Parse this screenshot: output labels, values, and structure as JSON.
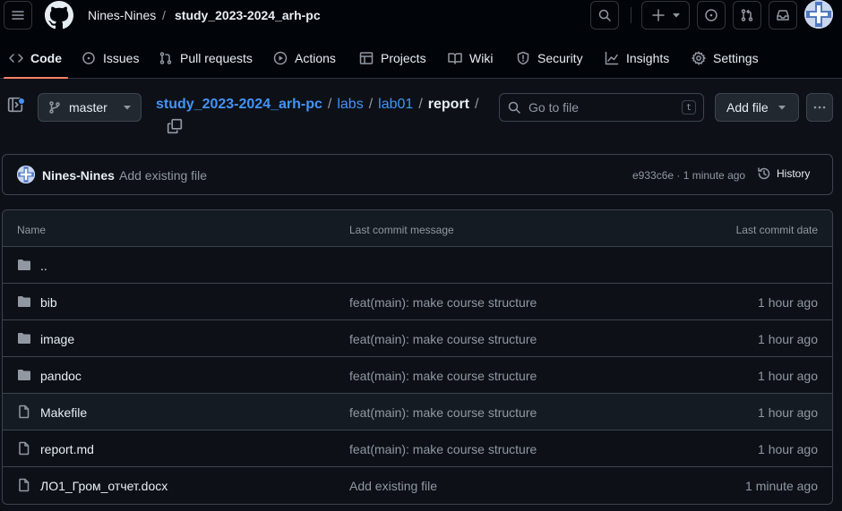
{
  "header": {
    "owner": "Nines-Nines",
    "separator": "/",
    "repo": "study_2023-2024_arh-pc"
  },
  "tabs": [
    {
      "label": "Code",
      "icon": "code-icon"
    },
    {
      "label": "Issues",
      "icon": "issue-icon"
    },
    {
      "label": "Pull requests",
      "icon": "pull-request-icon"
    },
    {
      "label": "Actions",
      "icon": "play-icon"
    },
    {
      "label": "Projects",
      "icon": "table-icon"
    },
    {
      "label": "Wiki",
      "icon": "book-icon"
    },
    {
      "label": "Security",
      "icon": "shield-icon"
    },
    {
      "label": "Insights",
      "icon": "graph-icon"
    },
    {
      "label": "Settings",
      "icon": "gear-icon"
    }
  ],
  "branch": {
    "name": "master"
  },
  "path": {
    "repo": "study_2023-2024_arh-pc",
    "parts": [
      "labs",
      "lab01"
    ],
    "current": "report",
    "sep": "/"
  },
  "goto": {
    "placeholder": "Go to file",
    "shortcut": "t"
  },
  "add_file": {
    "label": "Add file"
  },
  "latest_commit": {
    "author": "Nines-Nines",
    "message": "Add existing file",
    "meta": "e933c6e · 1 minute ago",
    "history_label": "History"
  },
  "table": {
    "headers": {
      "name": "Name",
      "message": "Last commit message",
      "date": "Last commit date"
    },
    "rows": [
      {
        "type": "folder",
        "name": "..",
        "message": "",
        "date": ""
      },
      {
        "type": "folder",
        "name": "bib",
        "message": "feat(main): make course structure",
        "date": "1 hour ago"
      },
      {
        "type": "folder",
        "name": "image",
        "message": "feat(main): make course structure",
        "date": "1 hour ago"
      },
      {
        "type": "folder",
        "name": "pandoc",
        "message": "feat(main): make course structure",
        "date": "1 hour ago"
      },
      {
        "type": "file",
        "name": "Makefile",
        "message": "feat(main): make course structure",
        "date": "1 hour ago"
      },
      {
        "type": "file",
        "name": "report.md",
        "message": "feat(main): make course structure",
        "date": "1 hour ago"
      },
      {
        "type": "file",
        "name": "ЛО1_Гром_отчет.docx",
        "message": "Add existing file",
        "date": "1 minute ago"
      }
    ]
  },
  "colors": {
    "accent_link": "#4493f8",
    "tab_underline": "#f78166",
    "folder": "#9198a1"
  }
}
